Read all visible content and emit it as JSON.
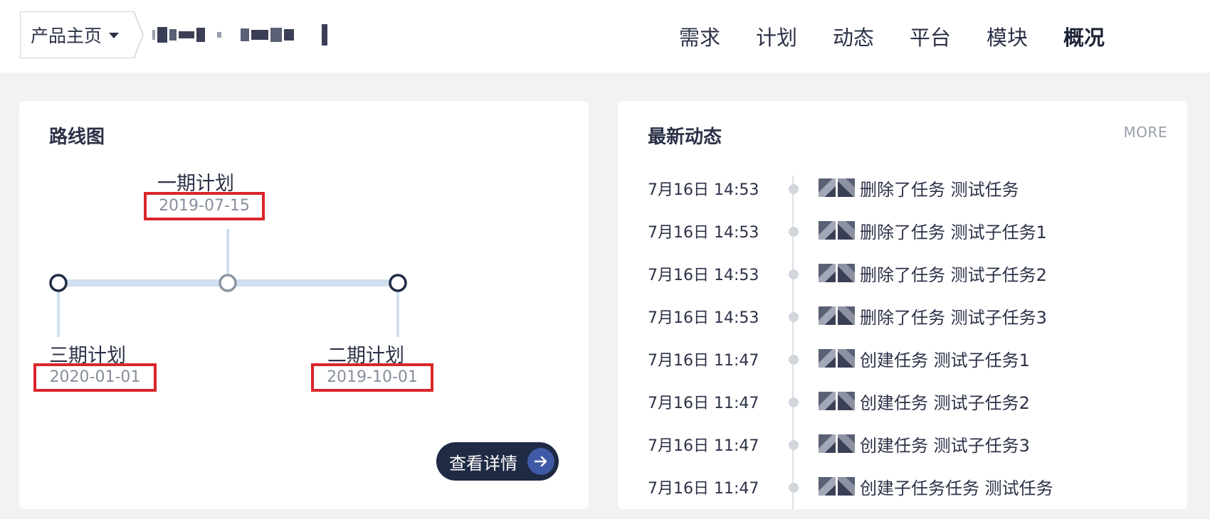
{
  "header": {
    "home_label": "产品主页",
    "nav": [
      "需求",
      "计划",
      "动态",
      "平台",
      "模块",
      "概况"
    ],
    "active_nav": "概况"
  },
  "roadmap": {
    "title": "路线图",
    "milestones": [
      {
        "name": "一期计划",
        "date": "2019-07-15"
      },
      {
        "name": "三期计划",
        "date": "2020-01-01"
      },
      {
        "name": "二期计划",
        "date": "2019-10-01"
      }
    ],
    "detail_button": "查看详情"
  },
  "activity": {
    "title": "最新动态",
    "more": "MORE",
    "items": [
      {
        "time": "7月16日 14:53",
        "text": "删除了任务 测试任务"
      },
      {
        "time": "7月16日 14:53",
        "text": "删除了任务 测试子任务1"
      },
      {
        "time": "7月16日 14:53",
        "text": "删除了任务 测试子任务2"
      },
      {
        "time": "7月16日 14:53",
        "text": "删除了任务 测试子任务3"
      },
      {
        "time": "7月16日 11:47",
        "text": "创建任务 测试子任务1"
      },
      {
        "time": "7月16日 11:47",
        "text": "创建任务 测试子任务2"
      },
      {
        "time": "7月16日 11:47",
        "text": "创建任务 测试子任务3"
      },
      {
        "time": "7月16日 11:47",
        "text": "创建子任务任务 测试任务"
      }
    ]
  },
  "colors": {
    "accent_dark": "#1f2a44",
    "highlight_box": "#d9262a",
    "timeline_track": "#cfe0f0"
  }
}
